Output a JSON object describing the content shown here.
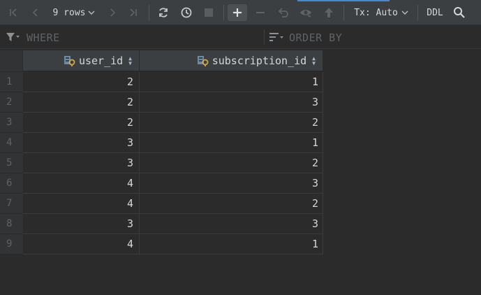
{
  "toolbar": {
    "rows_label": "9 rows",
    "tx_label": "Tx: Auto",
    "ddl_label": "DDL"
  },
  "filter": {
    "where_label": "WHERE",
    "order_by_label": "ORDER BY"
  },
  "columns": [
    "user_id",
    "subscription_id"
  ],
  "rows": [
    {
      "num": "1",
      "user_id": "2",
      "subscription_id": "1"
    },
    {
      "num": "2",
      "user_id": "2",
      "subscription_id": "3"
    },
    {
      "num": "3",
      "user_id": "2",
      "subscription_id": "2"
    },
    {
      "num": "4",
      "user_id": "3",
      "subscription_id": "1"
    },
    {
      "num": "5",
      "user_id": "3",
      "subscription_id": "2"
    },
    {
      "num": "6",
      "user_id": "4",
      "subscription_id": "3"
    },
    {
      "num": "7",
      "user_id": "4",
      "subscription_id": "2"
    },
    {
      "num": "8",
      "user_id": "3",
      "subscription_id": "3"
    },
    {
      "num": "9",
      "user_id": "4",
      "subscription_id": "1"
    }
  ],
  "colors": {
    "background": "#2b2b2b",
    "toolbar": "#3c3f41",
    "text": "#d6d6d6",
    "muted": "#606366",
    "key_icon": "#4a88c7"
  }
}
